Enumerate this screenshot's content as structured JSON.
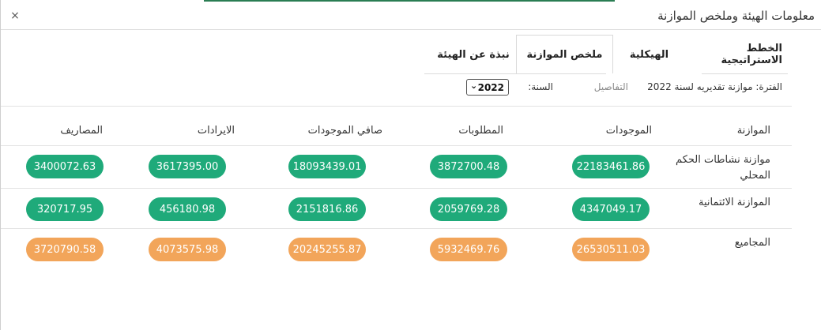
{
  "window": {
    "title": "معلومات الهيئة وملخص الموازنة",
    "close_glyph": "×"
  },
  "tabs": [
    {
      "label": "نبذة عن الهيئة",
      "active": false
    },
    {
      "label": "ملخص الموازنة",
      "active": true
    },
    {
      "label": "الهيكلية",
      "active": false
    },
    {
      "label": "الخطط الاستراتيجية",
      "active": false
    }
  ],
  "filters": {
    "period": "الفترة: موازنة تقديريه لسنة 2022",
    "details": "التفاصيل",
    "year_label": "السنة:",
    "year_value": "2022",
    "chevron": "⌄"
  },
  "table": {
    "headers": [
      "الموازنة",
      "الموجودات",
      "المطلوبات",
      "صافي الموجودات",
      "الايرادات",
      "المصاريف"
    ],
    "rows": [
      {
        "name": "موازنة نشاطات الحكم المحلي",
        "values": [
          "22183461.86",
          "3872700.48",
          "18093439.01",
          "3617395.00",
          "3400072.63"
        ],
        "color": "#1faa7a"
      },
      {
        "name": "الموازنة الائتمانية",
        "values": [
          "4347049.17",
          "2059769.28",
          "2151816.86",
          "456180.98",
          "320717.95"
        ],
        "color": "#1faa7a"
      },
      {
        "name": "المجاميع",
        "values": [
          "26530511.03",
          "5932469.76",
          "20245255.87",
          "4073575.98",
          "3720790.58"
        ],
        "color": "#f2a55a"
      }
    ]
  },
  "colors": {
    "accent": "#2a7d53",
    "pill_green": "#1faa7a",
    "pill_orange": "#f2a55a"
  }
}
